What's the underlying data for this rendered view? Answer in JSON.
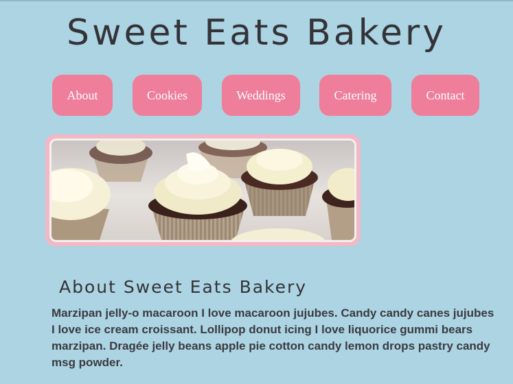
{
  "header": {
    "title": "Sweet Eats Bakery"
  },
  "nav": {
    "items": [
      {
        "label": "About"
      },
      {
        "label": "Cookies"
      },
      {
        "label": "Weddings"
      },
      {
        "label": "Catering"
      },
      {
        "label": "Contact"
      }
    ]
  },
  "hero": {
    "image": "cupcakes-photo"
  },
  "about": {
    "heading": "About Sweet Eats Bakery",
    "body": "Marzipan jelly-o macaroon I love macaroon jujubes. Candy candy canes jujubes I love ice cream croissant. Lollipop donut icing I love liquorice gummi bears marzipan. Dragée jelly beans apple pie cotton candy lemon drops pastry candy msg powder."
  },
  "colors": {
    "background": "#acd4e3",
    "nav_button": "#ef7e9b",
    "hero_frame": "#f2b8c6",
    "text": "#333338"
  }
}
